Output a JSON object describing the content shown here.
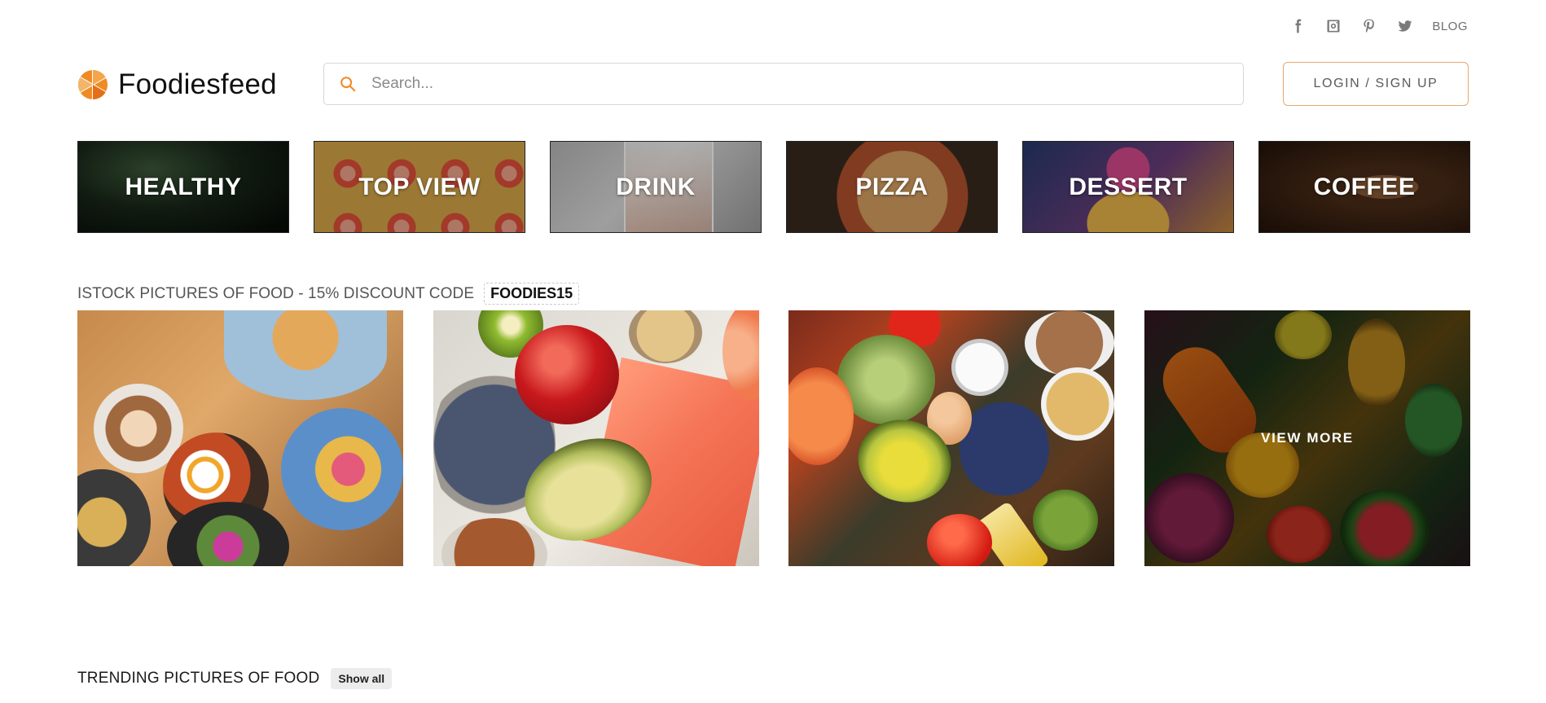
{
  "topbar": {
    "social": [
      {
        "name": "facebook-icon"
      },
      {
        "name": "instagram-icon"
      },
      {
        "name": "pinterest-icon"
      },
      {
        "name": "twitter-icon"
      }
    ],
    "blog_label": "BLOG"
  },
  "header": {
    "logo_text": "Foodiesfeed",
    "search_placeholder": "Search...",
    "login_label": "LOGIN / SIGN UP"
  },
  "categories": [
    {
      "label": "HEALTHY"
    },
    {
      "label": "TOP VIEW"
    },
    {
      "label": "DRINK"
    },
    {
      "label": "PIZZA"
    },
    {
      "label": "DESSERT"
    },
    {
      "label": "COFFEE"
    }
  ],
  "istock": {
    "title": "ISTOCK PICTURES OF FOOD - 15% DISCOUNT CODE",
    "code": "FOODIES15",
    "view_more_label": "VIEW MORE"
  },
  "trending": {
    "title": "TRENDING PICTURES OF FOOD",
    "show_all_label": "Show all"
  },
  "colors": {
    "accent": "#f08a24",
    "login_border": "#e8a86e",
    "text_muted": "#7a7a7a"
  }
}
